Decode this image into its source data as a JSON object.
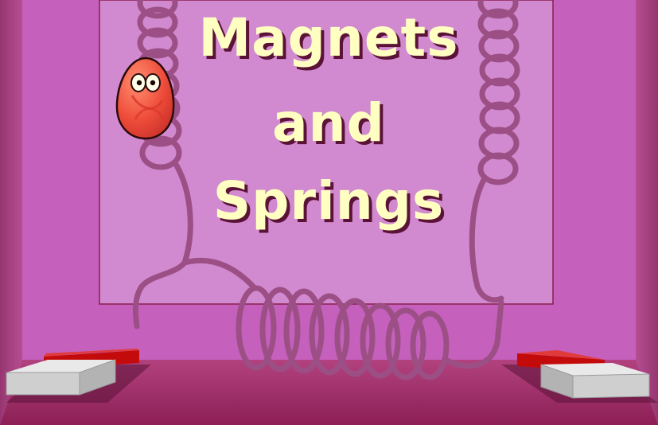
{
  "title": {
    "line1": "Magnets",
    "line2": "and",
    "line3": "Springs"
  },
  "colors": {
    "wall": "#c560bd",
    "panel": "#d18ad0",
    "panel_border": "#8a1f4c",
    "floor": "#a2306a",
    "spring": "#9c4f85",
    "title_fill": "#ffffc2",
    "title_shadow": "#5a1236",
    "magnet_red": "#c40b0b",
    "magnet_grey": "#d2d2d2",
    "character_body": "#ef5540"
  },
  "scene": {
    "character": "red-egg-character",
    "left_magnet": "bar-magnet",
    "right_magnet": "bar-magnet"
  }
}
